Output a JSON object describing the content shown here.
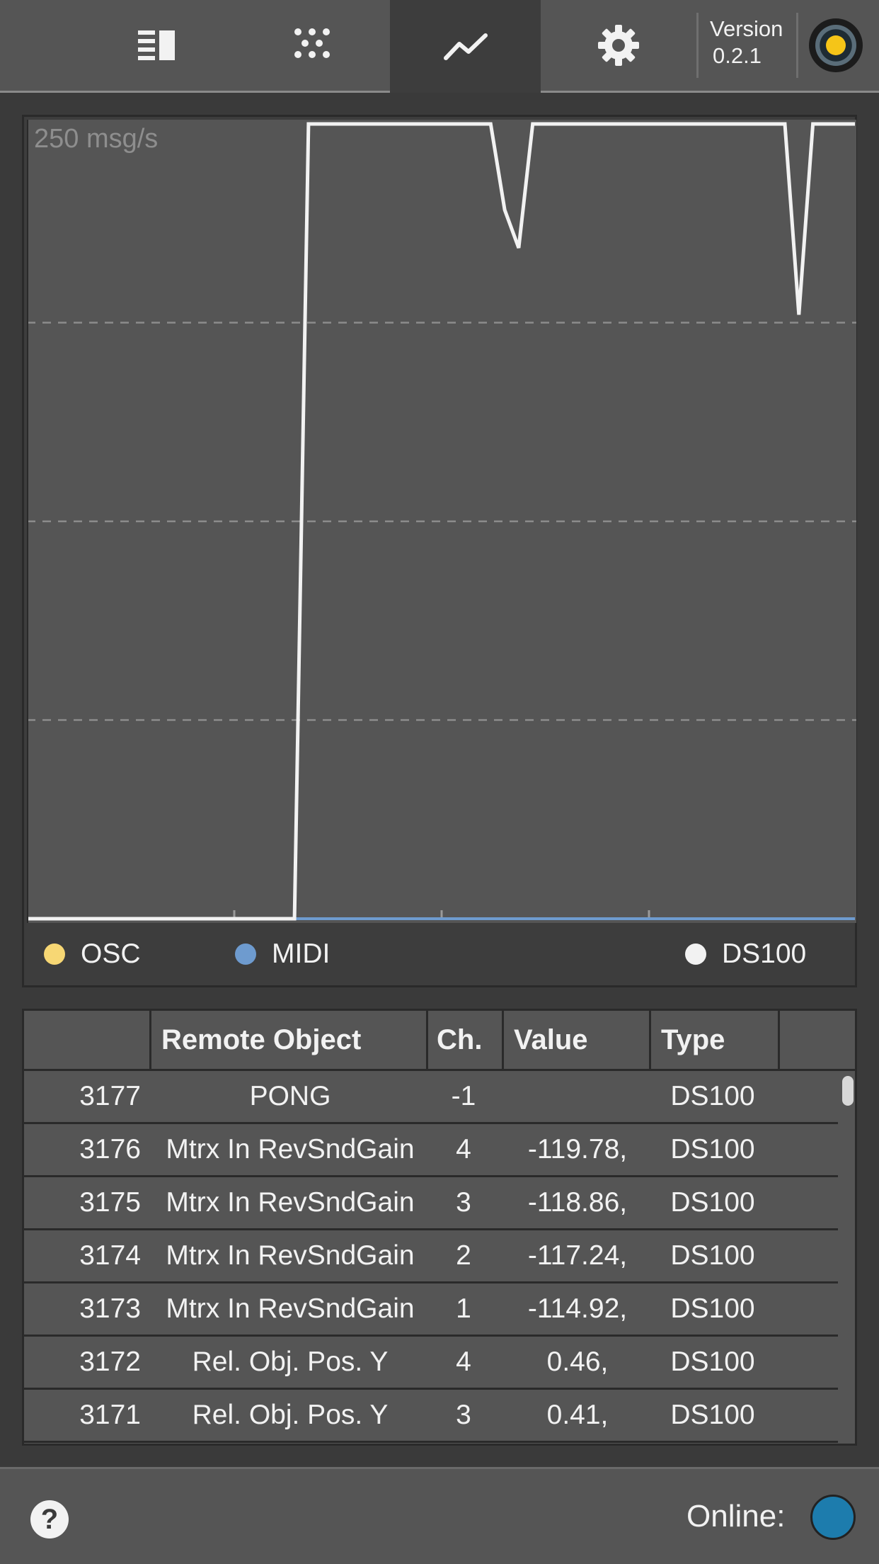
{
  "tabs": [
    {
      "name": "table-view",
      "icon": "list-icon",
      "active": false
    },
    {
      "name": "sound-objects",
      "icon": "dots-grid-icon",
      "active": false
    },
    {
      "name": "statistics",
      "icon": "line-chart-icon",
      "active": true
    },
    {
      "name": "settings",
      "icon": "gear-icon",
      "active": false
    }
  ],
  "header": {
    "version_label": "Version",
    "version_number": "0.2.1",
    "status_color": "#f5c518"
  },
  "chart": {
    "rate_label": "250 msg/s",
    "legend": [
      {
        "label": "OSC",
        "color": "#f7d774"
      },
      {
        "label": "MIDI",
        "color": "#6e9bcf"
      },
      {
        "label": "DS100",
        "color": "#f2f2f2"
      }
    ]
  },
  "chart_data": {
    "type": "line",
    "title": "",
    "ylabel": "",
    "xlabel": "",
    "ylim": [
      0,
      250
    ],
    "grid": true,
    "legend_position": "bottom",
    "x": [
      0,
      1,
      2,
      3,
      4,
      5,
      6,
      7,
      8,
      9,
      10,
      11,
      12,
      13,
      14,
      15,
      16,
      17,
      18,
      19,
      20,
      21,
      22,
      23,
      24,
      25,
      26,
      27,
      28,
      29,
      30,
      31,
      32,
      33,
      34,
      35,
      36,
      37,
      38,
      39,
      40,
      41,
      42,
      43,
      44,
      45,
      46,
      47,
      48,
      49,
      50,
      51,
      52,
      53,
      54,
      55,
      56,
      57,
      58,
      59
    ],
    "series": [
      {
        "name": "OSC",
        "color": "#f7d774",
        "values": [
          0,
          0,
          0,
          0,
          0,
          0,
          0,
          0,
          0,
          0,
          0,
          0,
          0,
          0,
          0,
          0,
          0,
          0,
          0,
          0,
          0,
          0,
          0,
          0,
          0,
          0,
          0,
          0,
          0,
          0,
          0,
          0,
          0,
          0,
          0,
          0,
          0,
          0,
          0,
          0,
          0,
          0,
          0,
          0,
          0,
          0,
          0,
          0,
          0,
          0,
          0,
          0,
          0,
          0,
          0,
          0,
          0,
          0,
          0,
          0
        ]
      },
      {
        "name": "MIDI",
        "color": "#6e9bcf",
        "values": [
          0,
          0,
          0,
          0,
          0,
          0,
          0,
          0,
          0,
          0,
          0,
          0,
          0,
          0,
          0,
          0,
          0,
          0,
          0,
          0,
          0,
          0,
          0,
          0,
          0,
          0,
          0,
          0,
          0,
          0,
          0,
          0,
          0,
          0,
          0,
          0,
          0,
          0,
          0,
          0,
          0,
          0,
          0,
          0,
          0,
          0,
          0,
          0,
          0,
          0,
          0,
          0,
          0,
          0,
          0,
          0,
          0,
          0,
          0,
          0
        ]
      },
      {
        "name": "DS100",
        "color": "#f2f2f2",
        "values": [
          0,
          0,
          0,
          0,
          0,
          0,
          0,
          0,
          0,
          0,
          0,
          0,
          0,
          0,
          0,
          0,
          0,
          0,
          0,
          0,
          250,
          250,
          250,
          250,
          250,
          250,
          250,
          250,
          250,
          250,
          250,
          250,
          250,
          250,
          223,
          211,
          250,
          250,
          250,
          250,
          250,
          250,
          250,
          250,
          250,
          250,
          250,
          250,
          250,
          250,
          250,
          250,
          250,
          250,
          250,
          190,
          250,
          250,
          250,
          250
        ]
      }
    ]
  },
  "table": {
    "headers": [
      "",
      "Remote Object",
      "Ch.",
      "Value",
      "Type",
      ""
    ],
    "rows": [
      {
        "id": "3177",
        "object": "PONG",
        "ch": "-1",
        "value": "",
        "type": "DS100"
      },
      {
        "id": "3176",
        "object": "Mtrx In RevSndGain",
        "ch": "4",
        "value": "-119.78,",
        "type": "DS100"
      },
      {
        "id": "3175",
        "object": "Mtrx In RevSndGain",
        "ch": "3",
        "value": "-118.86,",
        "type": "DS100"
      },
      {
        "id": "3174",
        "object": "Mtrx In RevSndGain",
        "ch": "2",
        "value": "-117.24,",
        "type": "DS100"
      },
      {
        "id": "3173",
        "object": "Mtrx In RevSndGain",
        "ch": "1",
        "value": "-114.92,",
        "type": "DS100"
      },
      {
        "id": "3172",
        "object": "Rel. Obj. Pos. Y",
        "ch": "4",
        "value": "0.46,",
        "type": "DS100"
      },
      {
        "id": "3171",
        "object": "Rel. Obj. Pos. Y",
        "ch": "3",
        "value": "0.41,",
        "type": "DS100"
      }
    ]
  },
  "footer": {
    "help_label": "?",
    "online_label": "Online:",
    "online_color": "#1d7cad"
  }
}
